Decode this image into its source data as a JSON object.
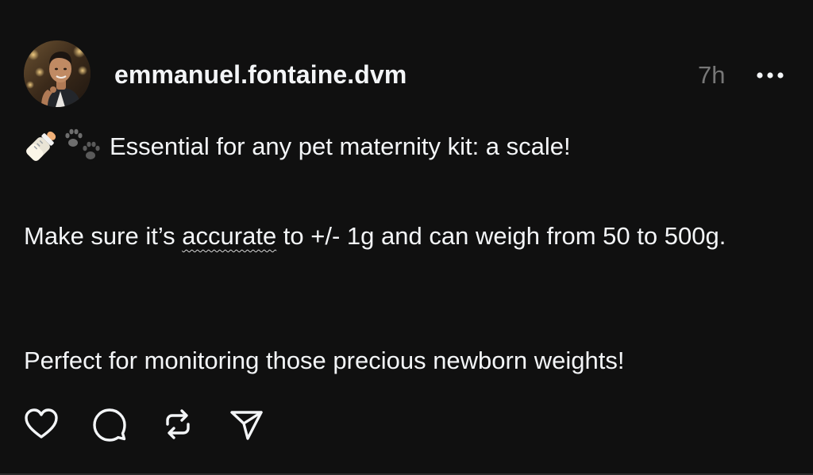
{
  "post": {
    "username": "emmanuel.fontaine.dvm",
    "timestamp": "7h",
    "emojis": [
      "baby-bottle",
      "paw-prints"
    ],
    "line1_text": "Essential for any pet maternity kit: a scale!",
    "para2_before": "Make sure it’s ",
    "para2_flagged": "accurate",
    "para2_after": " to +/- 1g and can weigh from 50 to 500g.",
    "para3_text": "Perfect for monitoring those precious newborn weights!"
  },
  "actions": {
    "icons": [
      "heart-icon",
      "comment-icon",
      "repost-icon",
      "send-icon"
    ]
  },
  "colors": {
    "background": "#101010",
    "text_primary": "#f3f5f7",
    "text_secondary": "#777777"
  }
}
